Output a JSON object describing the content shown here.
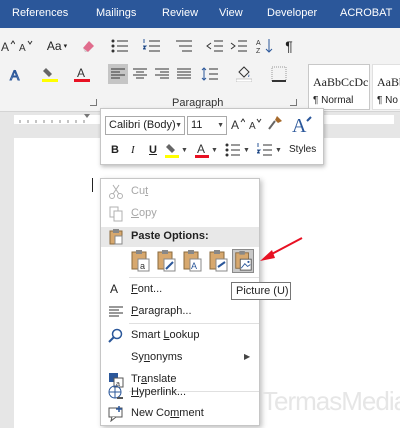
{
  "ribbon_tabs": [
    "References",
    "Mailings",
    "Review",
    "View",
    "Developer",
    "ACROBAT"
  ],
  "ribbon": {
    "group_label": "Paragraph",
    "case_button": "Aa",
    "styles": [
      {
        "sample": "AaBbCcDc",
        "name": "¶ Normal"
      },
      {
        "sample": "AaBbC",
        "name": "¶ No"
      }
    ]
  },
  "mini_toolbar": {
    "font_name": "Calibri (Body)",
    "font_size": "11",
    "styles_label": "Styles",
    "buttons": {
      "bold": "B",
      "italic": "I",
      "underline": "U"
    }
  },
  "context_menu": {
    "cut": {
      "before": "Cu",
      "key": "t",
      "after": ""
    },
    "copy": {
      "before": "",
      "key": "C",
      "after": "opy"
    },
    "paste_options": "Paste Options:",
    "font": {
      "before": "",
      "key": "F",
      "after": "ont..."
    },
    "paragraph": {
      "before": "",
      "key": "P",
      "after": "aragraph..."
    },
    "smart_lookup": {
      "before": "Smart ",
      "key": "L",
      "after": "ookup"
    },
    "synonyms": {
      "before": "Sy",
      "key": "n",
      "after": "onyms"
    },
    "translate": {
      "before": "Tr",
      "key": "a",
      "after": "nslate"
    },
    "hyperlink": {
      "before": "",
      "key": "H",
      "after": "yperlink..."
    },
    "new_comment": {
      "before": "New Co",
      "key": "m",
      "after": "ment"
    }
  },
  "tooltip": "Picture (U)",
  "watermark": "TermasMedia",
  "colors": {
    "tab_bar": "#2b579a",
    "highlight_yellow": "#ffff00",
    "font_red": "#e81123",
    "arrow_red": "#e81123",
    "accent_blue": "#2b579a"
  }
}
